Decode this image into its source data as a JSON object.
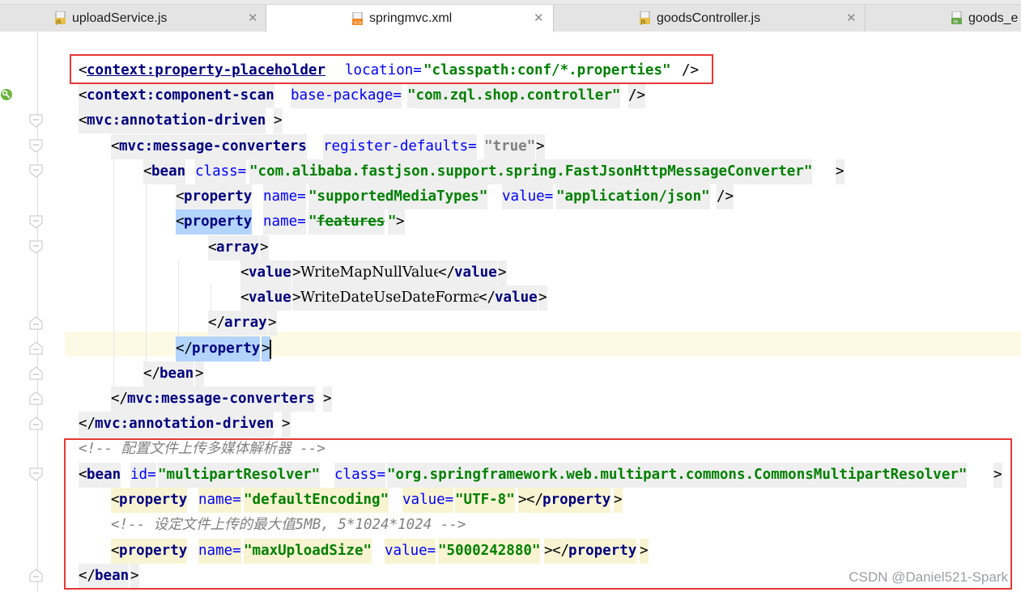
{
  "tabs": [
    {
      "label": "uploadService.js",
      "icon": "js-file-icon",
      "active": false
    },
    {
      "label": "springmvc.xml",
      "icon": "xml-file-icon",
      "active": true
    },
    {
      "label": "goodsController.js",
      "icon": "js-file-icon",
      "active": false
    },
    {
      "label": "goods_e",
      "icon": "html-file-icon",
      "active": false
    }
  ],
  "code": {
    "l1": {
      "open": "<",
      "tag": "context:property-placeholder",
      "sp": " ",
      "attr": "location=",
      "val": "\"classpath:conf/*.properties\"",
      "close": "/>"
    },
    "l2": {
      "open": "<",
      "tag": "context:component-scan",
      "sp": " ",
      "attr": "base-package=",
      "val": "\"com.zql.shop.controller\"",
      "close": "/>"
    },
    "l3": {
      "open": "<",
      "tag": "mvc:annotation-driven",
      "close": ">"
    },
    "l4": {
      "open": "<",
      "tag": "mvc:message-converters",
      "sp": " ",
      "attr": "register-defaults=",
      "val": "\"true\"",
      "close": ">"
    },
    "l5": {
      "open": "<",
      "tag": "bean",
      "sp": " ",
      "attr": "class=",
      "val": "\"com.alibaba.fastjson.support.spring.FastJsonHttpMessageConverter\"",
      "close": ">"
    },
    "l6": {
      "open": "<",
      "tag": "property",
      "sp": " ",
      "attr": "name=",
      "val": "\"supportedMediaTypes\"",
      "sp2": " ",
      "attr2": "value=",
      "val2": "\"application/json\"",
      "close": "/>"
    },
    "l7": {
      "open": "<",
      "tag": "property",
      "sp": " ",
      "attr": "name=",
      "q1": "\"",
      "val": "features",
      "q2": "\"",
      "close": ">"
    },
    "l8": {
      "open": "<",
      "tag": "array",
      "close": ">"
    },
    "l9": {
      "open": "<",
      "tag": "value",
      "close": ">",
      "text": "WriteMapNullValue",
      "copen": "</",
      "ctag": "value",
      "cclose": ">"
    },
    "l10": {
      "open": "<",
      "tag": "value",
      "close": ">",
      "text": "WriteDateUseDateFormat",
      "copen": "</",
      "ctag": "value",
      "cclose": ">"
    },
    "l11": {
      "open": "</",
      "tag": "array",
      "close": ">"
    },
    "l12": {
      "open": "</",
      "tag": "property",
      "close": ">"
    },
    "l13": {
      "open": "</",
      "tag": "bean",
      "close": ">"
    },
    "l14": {
      "open": "</",
      "tag": "mvc:message-converters",
      "close": ">"
    },
    "l15": {
      "open": "</",
      "tag": "mvc:annotation-driven",
      "close": ">"
    },
    "l16": {
      "comment": "<!-- 配置文件上传多媒体解析器 -->"
    },
    "l17": {
      "open": "<",
      "tag": "bean",
      "sp": " ",
      "attr": "id=",
      "val": "\"multipartResolver\"",
      "sp2": " ",
      "attr2": "class=",
      "val2": "\"org.springframework.web.multipart.commons.CommonsMultipartResolver\"",
      "close": ">"
    },
    "l18": {
      "open": "<",
      "tag": "property",
      "sp": " ",
      "attr": "name=",
      "val": "\"defaultEncoding\"",
      "sp2": " ",
      "attr2": "value=",
      "val2": "\"UTF-8\"",
      "close": ">",
      "copen": "</",
      "ctag": "property",
      "cclose": ">"
    },
    "l19": {
      "comment": "<!-- 设定文件上传的最大值5MB, 5*1024*1024 -->"
    },
    "l20": {
      "open": "<",
      "tag": "property",
      "sp": " ",
      "attr": "name=",
      "val": "\"maxUploadSize\"",
      "sp2": " ",
      "attr2": "value=",
      "val2": "\"5000242880\"",
      "close": ">",
      "copen": "</",
      "ctag": "property",
      "cclose": ">"
    },
    "l21": {
      "open": "</",
      "tag": "bean",
      "close": ">"
    }
  },
  "watermark": "CSDN @Daniel521-Spark",
  "colors": {
    "highlight_box": "#e53935",
    "tag": "#000080",
    "attribute": "#0000ff",
    "value": "#008000",
    "comment": "#808080"
  }
}
